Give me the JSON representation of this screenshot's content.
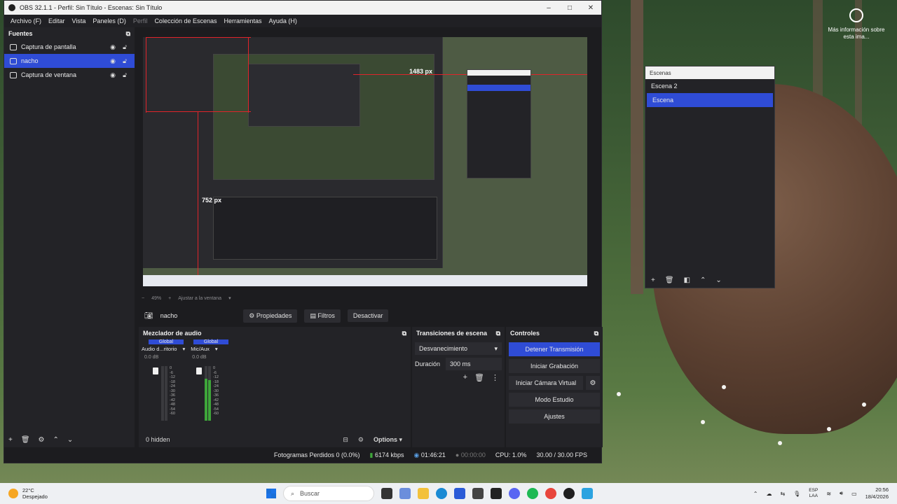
{
  "window": {
    "title": "OBS 32.1.1 - Perfil: Sin Título - Escenas: Sin Título",
    "controls": {
      "minimize": "–",
      "maximize": "□",
      "close": "✕"
    }
  },
  "menu": [
    {
      "label": "Archivo (F)",
      "enabled": true
    },
    {
      "label": "Editar",
      "enabled": true
    },
    {
      "label": "Vista",
      "enabled": true
    },
    {
      "label": "Paneles (D)",
      "enabled": true
    },
    {
      "label": "Perfil",
      "enabled": false
    },
    {
      "label": "Colección de Escenas",
      "enabled": true
    },
    {
      "label": "Herramientas",
      "enabled": true
    },
    {
      "label": "Ayuda (H)",
      "enabled": true
    }
  ],
  "sources": {
    "title": "Fuentes",
    "items": [
      {
        "label": "Captura de pantalla",
        "selected": false
      },
      {
        "label": "nacho",
        "selected": true
      },
      {
        "label": "Captura de ventana",
        "selected": false
      }
    ]
  },
  "preview": {
    "width_label": "1483 px",
    "height_label": "752 px",
    "zoom": "49%",
    "fit_label": "Ajustar a la ventana"
  },
  "context": {
    "source_name": "nacho",
    "properties": "Propiedades",
    "filters": "Filtros",
    "deactivate": "Desactivar"
  },
  "mixer": {
    "title": "Mezclador de audio",
    "channels": [
      {
        "tag": "Global",
        "name": "Audio d...ritorio",
        "db": "0.0 dB"
      },
      {
        "tag": "Global",
        "name": "Mic/Aux",
        "db": "0.0 dB"
      }
    ],
    "scale": [
      "0",
      "-6",
      "-12",
      "-18",
      "-24",
      "-30",
      "-36",
      "-42",
      "-48",
      "-54",
      "-60"
    ],
    "hidden": "0 hidden",
    "options": "Options"
  },
  "transitions": {
    "title": "Transiciones de escena",
    "selected": "Desvanecimiento",
    "duration_label": "Duración",
    "duration_value": "300 ms"
  },
  "controls": {
    "title": "Controles",
    "stop_stream": "Detener Transmisión",
    "start_record": "Iniciar Grabación",
    "virtual_cam": "Iniciar Cámara Virtual",
    "studio_mode": "Modo Estudio",
    "settings": "Ajustes"
  },
  "status": {
    "dropped": "Fotogramas Perdidos 0 (0.0%)",
    "bitrate": "6174 kbps",
    "stream_time": "01:46:21",
    "rec_time": "00:00:00",
    "cpu": "CPU: 1.0%",
    "fps": "30.00 / 30.00 FPS"
  },
  "scenes": {
    "title": "Escenas",
    "items": [
      {
        "label": "Escena 2",
        "selected": false
      },
      {
        "label": "Escena",
        "selected": true
      }
    ]
  },
  "desktop": {
    "info": "Más información sobre esta ima..."
  },
  "taskbar": {
    "temp": "22°C",
    "weather": "Despejado",
    "search": "Buscar",
    "lang1": "ESP",
    "lang2": "LAA",
    "time": "20:56",
    "date": "18/4/2026"
  },
  "colors": {
    "accent": "#2f4cd6",
    "panel": "#232327",
    "window": "#1c1c1f",
    "guide": "#e0242a"
  }
}
